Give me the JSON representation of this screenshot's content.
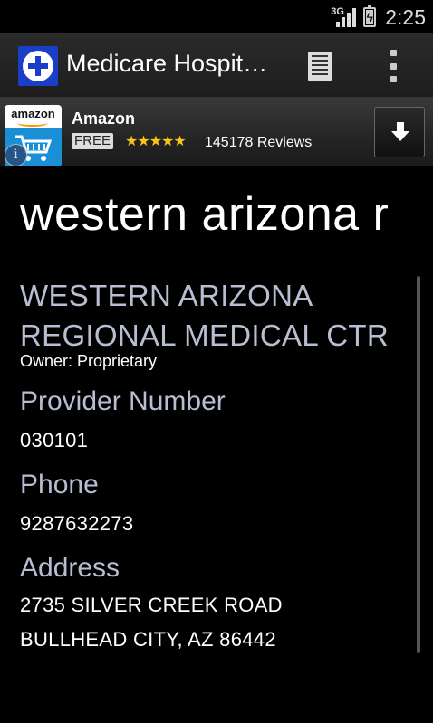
{
  "status_bar": {
    "network_type": "3G",
    "time": "2:25"
  },
  "action_bar": {
    "title": "Medicare Hospit…",
    "icons": {
      "app": "medical-cross-icon",
      "list": "list-icon",
      "overflow": "overflow-menu-icon"
    }
  },
  "ad": {
    "logo_text": "amazon",
    "title": "Amazon",
    "price_badge": "FREE",
    "rating_stars": "★★★★★",
    "reviews": "145178 Reviews",
    "rating": 4.5
  },
  "page": {
    "heading": "western arizona r"
  },
  "hospital": {
    "name": "WESTERN ARIZONA REGIONAL MEDICAL CTR",
    "owner": "Owner: Proprietary",
    "provider_label": "Provider Number",
    "provider_value": "030101",
    "phone_label": "Phone",
    "phone_value": "9287632273",
    "address_label": "Address",
    "address_line1": "2735 SILVER CREEK ROAD",
    "address_line2": "BULLHEAD CITY, AZ 86442"
  },
  "colors": {
    "background": "#000000",
    "section_label": "#b8bdd2",
    "app_icon_blue": "#1a3ec8",
    "stars": "#f5c518"
  }
}
